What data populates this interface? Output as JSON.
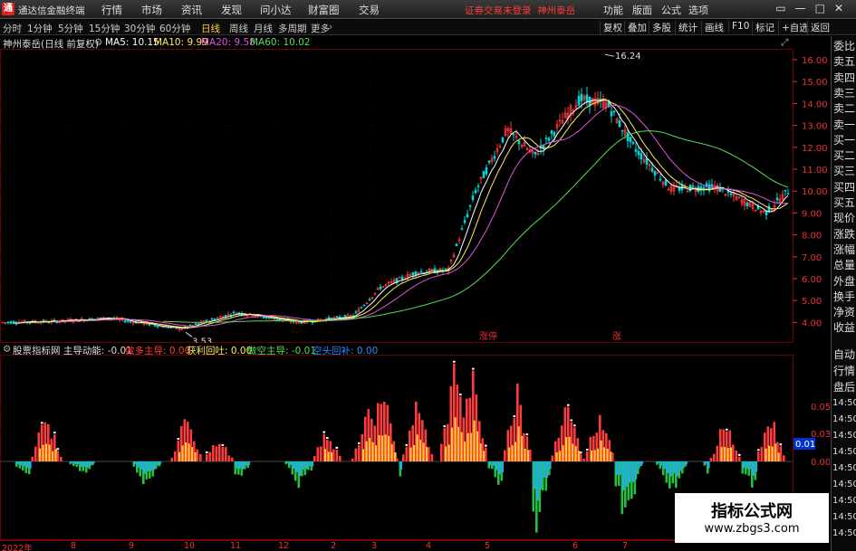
{
  "app": {
    "title": "通达信金融终端"
  },
  "menu": [
    "行情",
    "市场",
    "资讯",
    "发现",
    "问小达",
    "财富圈",
    "交易"
  ],
  "broker_status": "证券交易未登录",
  "stock_name_top": "神州泰岳",
  "right_menu": [
    "功能",
    "版面",
    "公式",
    "选项"
  ],
  "periods": [
    {
      "label": "分时",
      "active": false
    },
    {
      "label": "1分钟",
      "active": false
    },
    {
      "label": "5分钟",
      "active": false
    },
    {
      "label": "15分钟",
      "active": false
    },
    {
      "label": "30分钟",
      "active": false
    },
    {
      "label": "60分钟",
      "active": false
    },
    {
      "label": "日线",
      "active": true
    },
    {
      "label": "周线",
      "active": false
    },
    {
      "label": "月线",
      "active": false
    },
    {
      "label": "多周期",
      "active": false
    },
    {
      "label": "更多",
      "active": false
    }
  ],
  "right_tools": [
    "复权",
    "叠加",
    "多股",
    "统计",
    "画线",
    "F10",
    "标记",
    "+自选",
    "返回"
  ],
  "price_header": {
    "title": "神州泰岳(日线 前复权)",
    "ma5": "MA5: 10.15",
    "ma10": "MA10: 9.99",
    "ma20": "MA20: 9.58",
    "ma60": "MA60: 10.02"
  },
  "colors": {
    "ma5": "#ffffff",
    "ma10": "#ffee55",
    "ma20": "#dd55dd",
    "ma60": "#55dd55",
    "up": "#ff3b3b",
    "down": "#00d8d8",
    "grid": "#5a0000"
  },
  "price_axis": [
    "16.00",
    "15.00",
    "14.00",
    "13.00",
    "12.00",
    "11.00",
    "10.00",
    "9.00",
    "8.00",
    "7.00",
    "6.00",
    "5.00",
    "4.00"
  ],
  "annotations": {
    "high": "16.24",
    "low": "3.53",
    "tag1": "涨停",
    "tag2": "涨"
  },
  "indicator_header": {
    "name": "股票指标网 主导动能: -0.01",
    "l1": "做多主导: 0.00",
    "l2": "获利回吐: 0.00",
    "l3": "做空主导: -0.01",
    "l4": "空头回补: 0.00"
  },
  "indicator_axis": [
    "0.05",
    "0.03",
    "0.00"
  ],
  "indicator_value": "0.01",
  "right_tabs_top": [
    "委比",
    "卖五",
    "卖四",
    "卖三",
    "卖二",
    "卖一",
    "买一",
    "买二",
    "买三",
    "买四",
    "买五",
    "现价",
    "涨跌",
    "涨幅",
    "总量",
    "外盘",
    "换手",
    "净资",
    "收益"
  ],
  "right_tabs_bottom": [
    "自动",
    "行情",
    "盘后",
    "14:50",
    "14:50",
    "14:50",
    "14:50",
    "14:50",
    "14:50",
    "14:50",
    "14:50",
    "14:50"
  ],
  "date_labels": [
    "2022年",
    "8",
    "9",
    "10",
    "11",
    "12",
    "2",
    "3",
    "4",
    "5",
    "6",
    "7"
  ],
  "watermark": {
    "cn": "指标公式网",
    "url": "www.zbgs3.com"
  }
}
